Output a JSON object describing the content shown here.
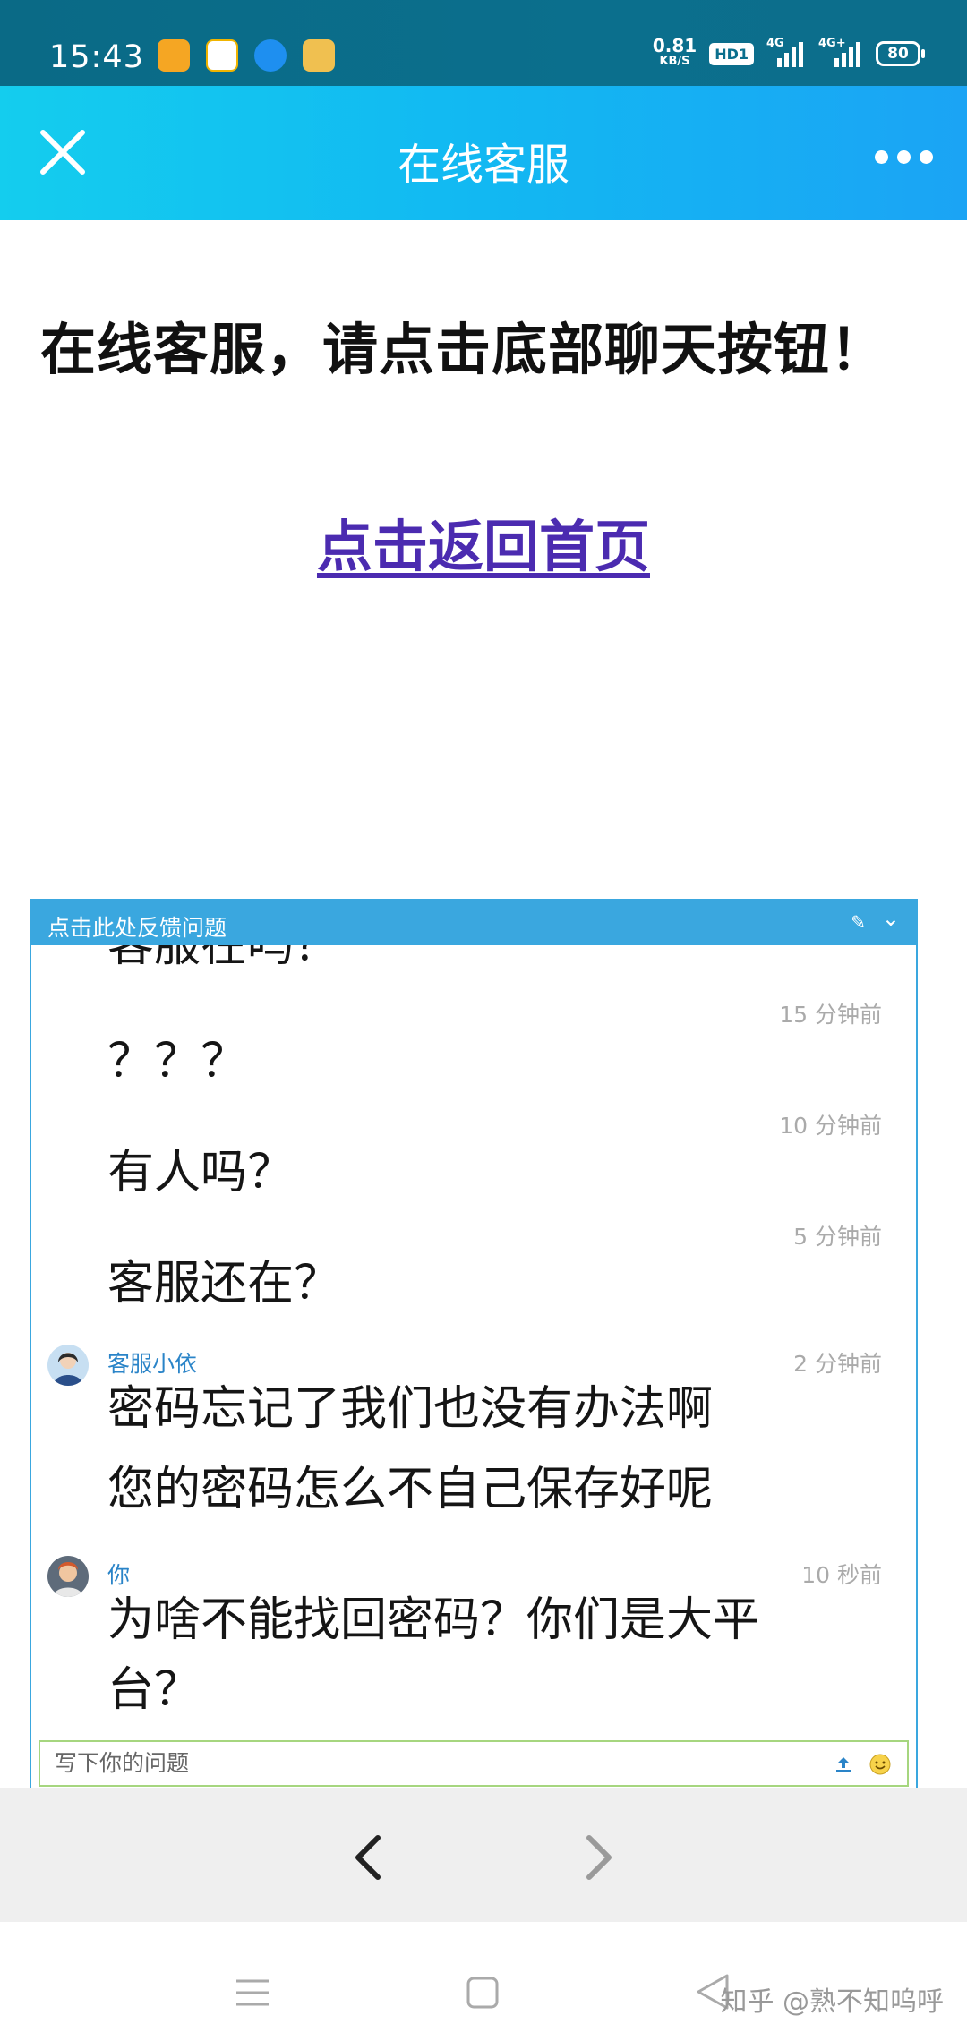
{
  "status_bar": {
    "time": "15:43",
    "net_speed_value": "0.81",
    "net_speed_unit": "KB/S",
    "hd_label": "HD1",
    "sig1_label": "4G",
    "sig2_label": "4G+",
    "battery": "80"
  },
  "header": {
    "title": "在线客服"
  },
  "page": {
    "heading": "在线客服，请点击底部聊天按钮！",
    "home_link": "点击返回首页"
  },
  "chat": {
    "header_title": "点击此处反馈问题",
    "messages": [
      {
        "time": "",
        "text": "客服在吗？"
      },
      {
        "time": "15 分钟前",
        "text": "？？？"
      },
      {
        "time": "10 分钟前",
        "text": "有人吗？"
      },
      {
        "time": "5 分钟前",
        "text": "客服还在？"
      },
      {
        "sender": "客服小依",
        "time": "2 分钟前",
        "text": "密码忘记了我们也没有办法啊",
        "text2": "您的密码怎么不自己保存好呢"
      },
      {
        "sender": "你",
        "time": "10 秒前",
        "text": "为啥不能找回密码？你们是大平",
        "text2": "台？"
      }
    ],
    "input_placeholder": "写下你的问题"
  },
  "watermark": "知乎 @熟不知呜呼",
  "colors": {
    "header_gradient_start": "#14cdee",
    "header_gradient_end": "#1ba4f4",
    "chat_accent": "#3aa7df",
    "link": "#4b2bb0",
    "input_border": "#a6d67f"
  }
}
